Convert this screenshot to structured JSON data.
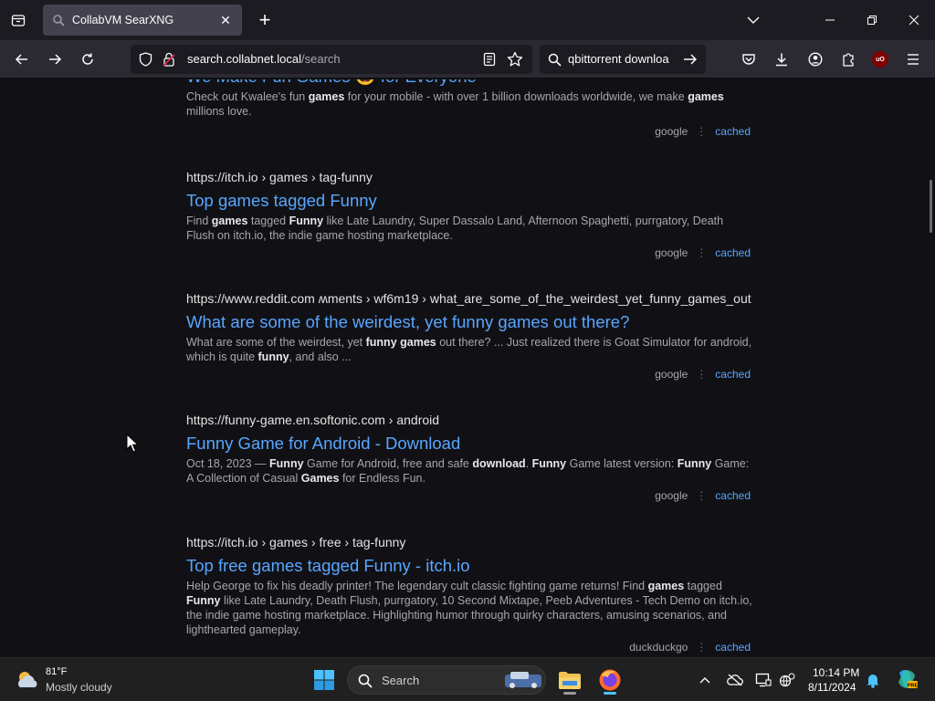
{
  "browser": {
    "tab": {
      "title": "CollabVM SearXNG"
    },
    "url": {
      "host": "search.collabnet.local",
      "path": "/search"
    },
    "search_box": {
      "value": "qbittorrent downloa"
    }
  },
  "results": [
    {
      "url": "",
      "title": "We Make Fun Games 😄 for Everyone",
      "snippet": [
        {
          "t": "Check out Kwalee's fun "
        },
        {
          "b": "games"
        },
        {
          "t": " for your mobile - with over 1 billion downloads worldwide, we make "
        },
        {
          "b": "games"
        },
        {
          "t": " millions love."
        }
      ],
      "engine": "google",
      "cached": "cached"
    },
    {
      "url": "https://itch.io  › games › tag-funny",
      "title": "Top games tagged Funny",
      "snippet": [
        {
          "t": "Find "
        },
        {
          "b": "games"
        },
        {
          "t": " tagged "
        },
        {
          "b": "Funny"
        },
        {
          "t": " like Late Laundry, Super Dassalo Land, Afternoon Spaghetti, purrgatory, Death Flush on itch.io, the indie game hosting marketplace."
        }
      ],
      "engine": "google",
      "cached": "cached"
    },
    {
      "url": "https://www.reddit.com  ʍments › wf6m19 › what_are_some_of_the_weirdest_yet_funny_games_out",
      "title": "What are some of the weirdest, yet funny games out there?",
      "snippet": [
        {
          "t": "What are some of the weirdest, yet "
        },
        {
          "b": "funny games"
        },
        {
          "t": " out there? ... Just realized there is Goat Simulator for android, which is quite "
        },
        {
          "b": "funny"
        },
        {
          "t": ", and also ..."
        }
      ],
      "engine": "google",
      "cached": "cached"
    },
    {
      "url": "https://funny-game.en.softonic.com  › android",
      "title": "Funny Game for Android - Download",
      "snippet": [
        {
          "t": "Oct 18, 2023 — "
        },
        {
          "b": "Funny"
        },
        {
          "t": " Game for Android, free and safe "
        },
        {
          "b": "download"
        },
        {
          "t": ". "
        },
        {
          "b": "Funny"
        },
        {
          "t": " Game latest version: "
        },
        {
          "b": "Funny"
        },
        {
          "t": " Game: A Collection of Casual "
        },
        {
          "b": "Games"
        },
        {
          "t": " for Endless Fun."
        }
      ],
      "engine": "google",
      "cached": "cached"
    },
    {
      "url": "https://itch.io  › games › free › tag-funny",
      "title": "Top free games tagged Funny - itch.io",
      "snippet": [
        {
          "t": "Help George to fix his deadly printer! The legendary cult classic fighting game returns! Find "
        },
        {
          "b": "games"
        },
        {
          "t": " tagged "
        },
        {
          "b": "Funny"
        },
        {
          "t": " like Late Laundry, Death Flush, purrgatory, 10 Second Mixtape, Peeb Adventures - Tech Demo on itch.io, the indie game hosting marketplace. Highlighting humor through quirky characters, amusing scenarios, and lighthearted gameplay."
        }
      ],
      "engine": "duckduckgo",
      "cached": "cached"
    }
  ],
  "taskbar": {
    "weather": {
      "temp": "81°F",
      "desc": "Mostly cloudy"
    },
    "search_label": "Search",
    "clock": {
      "time": "10:14 PM",
      "date": "8/11/2024"
    }
  },
  "colors": {
    "link": "#58a6ff",
    "tab_active": "#42414d",
    "toolbar": "#2b2a33",
    "page_bg": "#111115"
  }
}
